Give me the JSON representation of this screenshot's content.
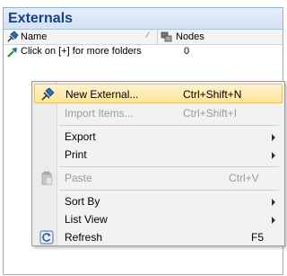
{
  "panel": {
    "title": "Externals"
  },
  "columns": {
    "name": "Name",
    "nodes": "Nodes"
  },
  "row": {
    "name": "Click on [+] for more folders",
    "nodes": "0"
  },
  "menu": {
    "new_external": {
      "label": "New External...",
      "shortcut": "Ctrl+Shift+N"
    },
    "import_items": {
      "label": "Import Items...",
      "shortcut": "Ctrl+Shift+I"
    },
    "export": {
      "label": "Export"
    },
    "print": {
      "label": "Print"
    },
    "paste": {
      "label": "Paste",
      "shortcut": "Ctrl+V"
    },
    "sort_by": {
      "label": "Sort By"
    },
    "list_view": {
      "label": "List View"
    },
    "refresh": {
      "label": "Refresh",
      "shortcut": "F5"
    }
  },
  "colors": {
    "title_text": "#15428b",
    "highlight": "#ffe49a",
    "disabled_text": "#9a9a9a"
  },
  "icons": {
    "name_column": "pushpin-icon",
    "nodes_column": "nodes-icon",
    "row": "external-link-icon",
    "new_external": "pushpin-icon",
    "paste": "clipboard-icon",
    "refresh": "refresh-icon"
  }
}
